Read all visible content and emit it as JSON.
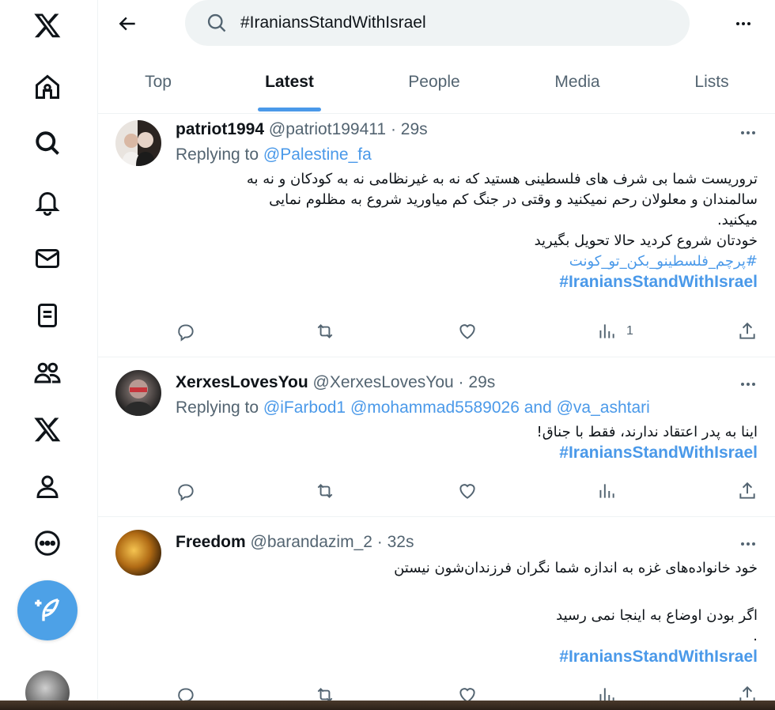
{
  "nav": {
    "icons": [
      "x-logo-icon",
      "home-icon",
      "explore-icon",
      "notifications-icon",
      "messages-icon",
      "lists-icon",
      "communities-icon",
      "premium-icon",
      "profile-icon",
      "more-icon"
    ],
    "compose_icon": "feather-plus-icon"
  },
  "header": {
    "search_value": "#IraniansStandWithIsrael",
    "tabs": [
      {
        "label": "Top",
        "active": false
      },
      {
        "label": "Latest",
        "active": true
      },
      {
        "label": "People",
        "active": false
      },
      {
        "label": "Media",
        "active": false
      },
      {
        "label": "Lists",
        "active": false
      }
    ]
  },
  "colors": {
    "accent": "#4a99e9",
    "muted": "#536471",
    "text": "#0f1419",
    "compose": "#4da1e7"
  },
  "tweets": [
    {
      "name": "patriot1994",
      "handle": "@patriot199411",
      "dot": "·",
      "time": "29s",
      "reply_prefix": "Replying to",
      "reply_to": "@Palestine_fa",
      "body_lines": [
        "تروریست شما بی شرف های فلسطینی هستید که نه به غیرنظامی نه به کودکان و نه به",
        "سالمندان و معلولان رحم نمیکنید و وقتی در جنگ کم میاورید شروع به مظلوم نمایی",
        "میکنید.",
        "خودتان شروع کردید حالا تحویل بگیرید"
      ],
      "hashtag_fa": "#پرچم_فلسطینو_بکن_تو_کونت",
      "hashtag_en": "#IraniansStandWithIsrael",
      "views": "1"
    },
    {
      "name": "XerxesLovesYou",
      "handle": "@XerxesLovesYou",
      "dot": "·",
      "time": "29s",
      "reply_prefix": "Replying to",
      "reply_to": "@iFarbod1 @mohammad5589026 and @va_ashtari",
      "body_lines": [
        "اینا به پدر اعتقاد ندارند، فقط با جناق!"
      ],
      "hashtag_en": "#IraniansStandWithIsrael",
      "views": ""
    },
    {
      "name": "Freedom",
      "handle": "@barandazim_2",
      "dot": "·",
      "time": "32s",
      "body_lines": [
        "خود خانواده‌های غزه به اندازه شما نگران فرزندان‌شون نیستن",
        "",
        "اگر بودن اوضاع به اینجا نمی رسید",
        "."
      ],
      "hashtag_en": "#IraniansStandWithIsrael",
      "views": ""
    }
  ]
}
